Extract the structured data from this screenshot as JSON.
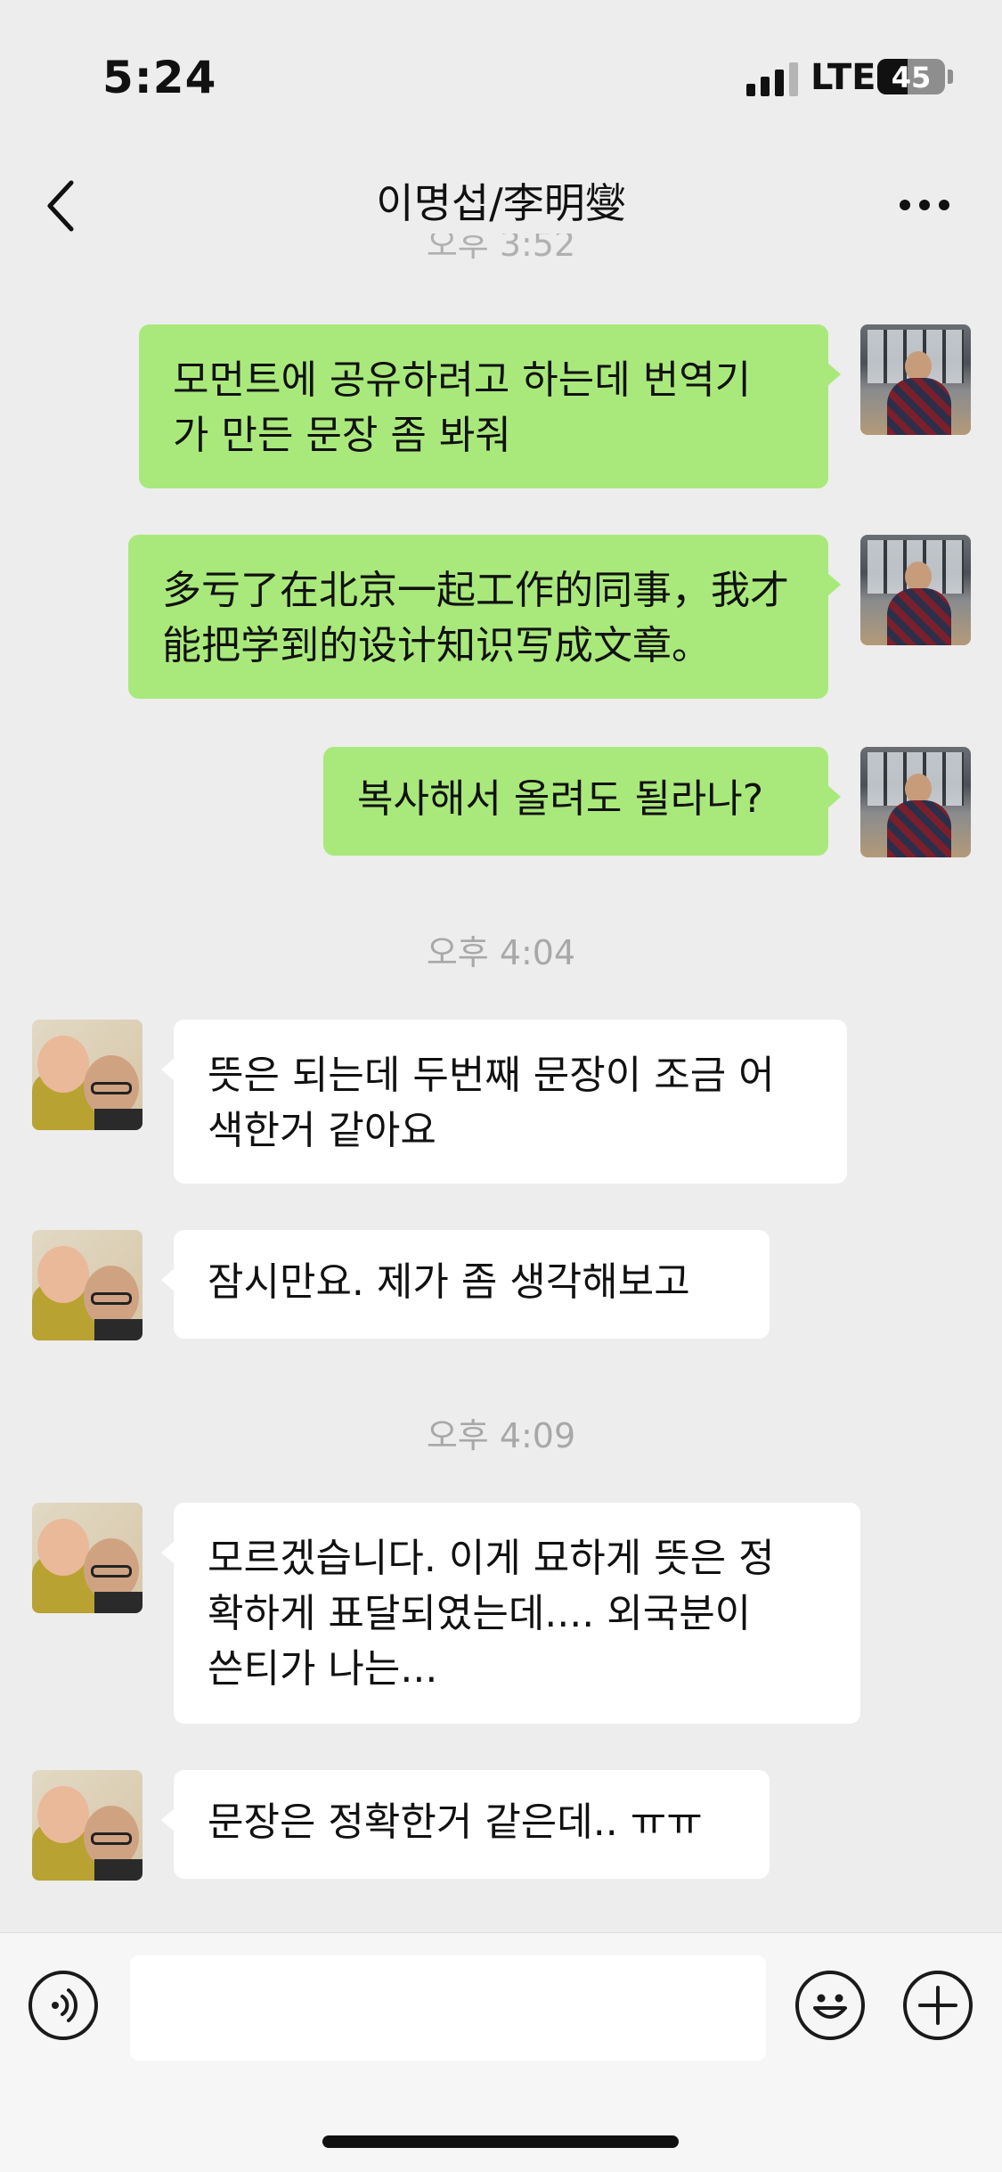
{
  "status_bar": {
    "time": "5:24",
    "network": "LTE",
    "battery": "45"
  },
  "nav": {
    "title": "이명섭/李明燮"
  },
  "clipped_timestamp": "오후 3:52",
  "messages": [
    {
      "side": "self",
      "text": "모먼트에 공유하려고 하는데 번역기\n가 만든 문장 좀 봐줘"
    },
    {
      "side": "self",
      "text": "多亏了在北京一起工作的同事，我才\n能把学到的设计知识写成文章。"
    },
    {
      "side": "self",
      "text": "복사해서 올려도 될라나?"
    },
    {
      "side": "timestamp",
      "text": "오후 4:04"
    },
    {
      "side": "other",
      "text": "뜻은 되는데 두번째 문장이 조금 어\n색한거 같아요"
    },
    {
      "side": "other",
      "text": "잠시만요.  제가 좀 생각해보고"
    },
    {
      "side": "timestamp",
      "text": "오후 4:09"
    },
    {
      "side": "other",
      "text": "모르겠습니다.  이게 묘하게 뜻은 정\n확하게 표달되였는데....   외국분이\n쓴티가 나는..."
    },
    {
      "side": "other",
      "text": "문장은 정확한거 같은데.. ㅠㅠ"
    }
  ],
  "input": {
    "value": ""
  },
  "icons": {
    "back": "chevron-left-icon",
    "more": "more-horizontal-icon",
    "voice": "voice-icon",
    "emoji": "emoji-icon",
    "plus": "plus-icon"
  },
  "colors": {
    "self_bubble": "#a9e97b",
    "other_bubble": "#ffffff",
    "background": "#ededed"
  }
}
